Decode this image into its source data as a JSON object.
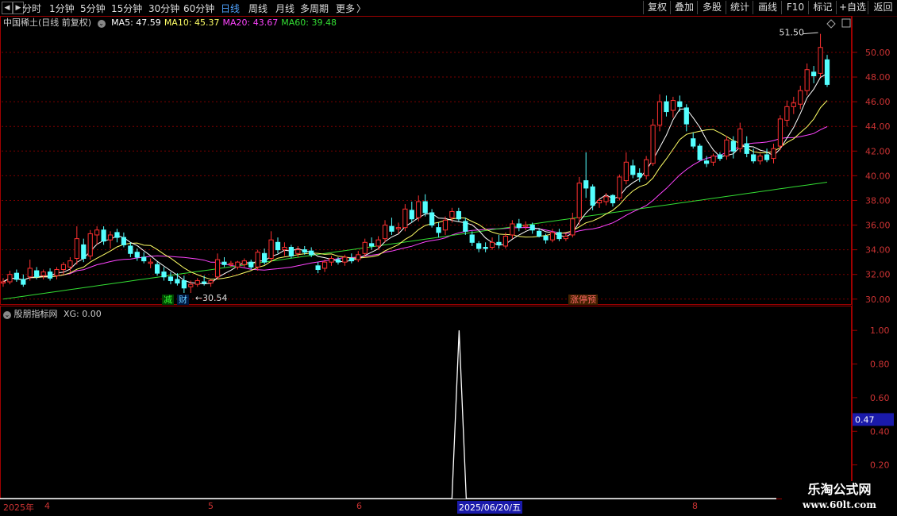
{
  "toolbar": {
    "nav_prev": "◀",
    "nav_next": "▶",
    "periods": [
      "分时",
      "1分钟",
      "5分钟",
      "15分钟",
      "30分钟",
      "60分钟",
      "日线",
      "周线",
      "月线",
      "多周期",
      "更多"
    ],
    "active_period": "日线",
    "more_arrow": "〉",
    "right_buttons": [
      "复权",
      "叠加",
      "多股",
      "统计",
      "画线",
      "F10",
      "标记",
      "+自选",
      "返回"
    ]
  },
  "stock": {
    "name": "中国稀土(日线 前复权)",
    "ma": [
      {
        "label": "MA5: 47.59",
        "color": "#ffffff"
      },
      {
        "label": "MA10: 45.37",
        "color": "#ffff66"
      },
      {
        "label": "MA20: 43.67",
        "color": "#ff44ff"
      },
      {
        "label": "MA60: 39.48",
        "color": "#33dd33"
      }
    ]
  },
  "price_axis": {
    "ticks": [
      "50.00",
      "48.00",
      "46.00",
      "44.00",
      "42.00",
      "40.00",
      "38.00",
      "36.00",
      "34.00",
      "32.00",
      "30.00"
    ]
  },
  "annotations": {
    "high": "51.50",
    "low": "30.54"
  },
  "markers": [
    {
      "text": "减",
      "color": "#33ff33",
      "bg": "#004400"
    },
    {
      "text": "财",
      "color": "#66ccff",
      "bg": "#001a44"
    },
    {
      "text": "涨停预",
      "color": "#ff6666",
      "bg": "#442200"
    }
  ],
  "indicator": {
    "title": "股朋指标网",
    "value": "XG: 0.00",
    "ticks": [
      "1.00",
      "0.80",
      "0.60",
      "0.40",
      "0.20"
    ],
    "cursor_value": "0.47"
  },
  "xaxis": {
    "year": "2025年",
    "months": [
      "4",
      "5",
      "6",
      "8"
    ],
    "cursor_date": "2025/06/20/五"
  },
  "watermark": {
    "line1": "乐淘公式网",
    "line2": "www.60lt.com"
  },
  "colors": {
    "up": "#ff3030",
    "down": "#54ffff",
    "grid": "#7a0000",
    "axis": "#a00000"
  },
  "chart_data": {
    "type": "candlestick",
    "title": "中国稀土(日线 前复权)",
    "ylim": [
      29.6,
      51.8
    ],
    "candles": [
      [
        31.3,
        31.7,
        31.0,
        31.4
      ],
      [
        31.4,
        32.3,
        31.2,
        32.0
      ],
      [
        32.1,
        32.4,
        31.4,
        31.6
      ],
      [
        31.6,
        32.0,
        31.0,
        31.2
      ],
      [
        31.8,
        33.2,
        31.5,
        32.5
      ],
      [
        32.3,
        32.6,
        31.6,
        31.8
      ],
      [
        31.9,
        32.4,
        31.6,
        32.2
      ],
      [
        32.2,
        32.5,
        31.5,
        31.7
      ],
      [
        31.9,
        32.6,
        31.6,
        32.4
      ],
      [
        32.4,
        33.0,
        32.0,
        32.8
      ],
      [
        32.6,
        33.4,
        32.2,
        33.1
      ],
      [
        33.3,
        35.9,
        32.8,
        34.9
      ],
      [
        34.4,
        34.9,
        33.0,
        33.3
      ],
      [
        33.5,
        35.6,
        33.2,
        35.3
      ],
      [
        35.2,
        35.9,
        34.4,
        35.6
      ],
      [
        35.6,
        35.9,
        34.4,
        34.7
      ],
      [
        34.8,
        35.5,
        34.1,
        35.2
      ],
      [
        35.4,
        35.7,
        34.6,
        35.0
      ],
      [
        35.0,
        35.4,
        34.2,
        34.4
      ],
      [
        34.3,
        34.6,
        33.4,
        33.7
      ],
      [
        33.8,
        34.1,
        33.1,
        33.4
      ],
      [
        33.4,
        33.8,
        32.9,
        33.1
      ],
      [
        32.9,
        33.3,
        32.5,
        33.0
      ],
      [
        32.8,
        33.0,
        31.9,
        32.1
      ],
      [
        32.2,
        32.6,
        31.5,
        31.8
      ],
      [
        31.8,
        32.2,
        31.2,
        31.5
      ],
      [
        31.6,
        32.1,
        31.1,
        31.3
      ],
      [
        31.5,
        31.9,
        30.5,
        30.9
      ],
      [
        31.0,
        31.5,
        30.5,
        31.2
      ],
      [
        31.2,
        31.7,
        31.0,
        31.5
      ],
      [
        31.4,
        31.9,
        31.1,
        31.3
      ],
      [
        31.3,
        31.6,
        31.0,
        31.5
      ],
      [
        31.8,
        33.7,
        31.6,
        33.2
      ],
      [
        33.0,
        33.4,
        32.6,
        32.8
      ],
      [
        32.8,
        33.1,
        32.6,
        32.9
      ],
      [
        32.6,
        33.1,
        32.4,
        33.0
      ],
      [
        32.8,
        33.3,
        32.6,
        33.1
      ],
      [
        33.0,
        33.2,
        32.4,
        32.6
      ],
      [
        32.6,
        34.0,
        32.3,
        33.8
      ],
      [
        33.7,
        34.1,
        32.8,
        33.0
      ],
      [
        33.3,
        35.5,
        33.0,
        34.8
      ],
      [
        34.6,
        35.0,
        33.7,
        34.0
      ],
      [
        34.0,
        34.6,
        33.5,
        34.2
      ],
      [
        34.2,
        34.4,
        33.3,
        33.5
      ],
      [
        33.7,
        34.3,
        33.4,
        34.0
      ],
      [
        34.0,
        34.3,
        33.6,
        33.8
      ],
      [
        33.9,
        34.2,
        33.4,
        33.6
      ],
      [
        32.7,
        33.0,
        32.1,
        32.4
      ],
      [
        32.5,
        33.2,
        32.2,
        33.0
      ],
      [
        33.0,
        33.5,
        32.7,
        33.3
      ],
      [
        33.2,
        33.4,
        32.8,
        33.0
      ],
      [
        33.0,
        33.6,
        32.7,
        33.4
      ],
      [
        33.3,
        33.7,
        32.9,
        33.1
      ],
      [
        33.2,
        33.9,
        33.0,
        33.6
      ],
      [
        33.7,
        34.9,
        33.4,
        34.6
      ],
      [
        34.5,
        35.0,
        34.0,
        34.3
      ],
      [
        34.3,
        35.1,
        34.0,
        34.8
      ],
      [
        34.9,
        36.4,
        34.6,
        36.0
      ],
      [
        35.9,
        36.6,
        35.2,
        35.5
      ],
      [
        35.7,
        36.2,
        35.3,
        35.8
      ],
      [
        35.8,
        37.7,
        35.5,
        37.3
      ],
      [
        37.2,
        37.9,
        36.2,
        36.5
      ],
      [
        36.6,
        38.4,
        36.3,
        37.9
      ],
      [
        37.9,
        38.5,
        36.7,
        37.0
      ],
      [
        37.0,
        37.3,
        35.8,
        36.0
      ],
      [
        35.8,
        36.2,
        35.0,
        35.4
      ],
      [
        35.6,
        36.7,
        35.2,
        36.4
      ],
      [
        36.6,
        37.4,
        36.2,
        37.1
      ],
      [
        37.1,
        37.4,
        36.3,
        36.5
      ],
      [
        36.3,
        36.6,
        35.2,
        35.5
      ],
      [
        35.2,
        35.5,
        34.3,
        34.6
      ],
      [
        34.5,
        34.7,
        33.8,
        34.1
      ],
      [
        34.2,
        34.6,
        33.8,
        34.1
      ],
      [
        34.2,
        35.0,
        34.0,
        34.6
      ],
      [
        34.6,
        35.2,
        34.1,
        34.4
      ],
      [
        34.3,
        35.4,
        34.1,
        35.1
      ],
      [
        35.2,
        36.4,
        34.9,
        36.1
      ],
      [
        36.1,
        36.5,
        35.5,
        35.8
      ],
      [
        35.9,
        36.3,
        35.6,
        36.0
      ],
      [
        36.0,
        36.2,
        35.3,
        35.6
      ],
      [
        35.5,
        35.7,
        35.0,
        35.1
      ],
      [
        35.1,
        35.3,
        34.5,
        34.8
      ],
      [
        34.8,
        35.7,
        34.6,
        35.4
      ],
      [
        35.4,
        35.7,
        34.7,
        34.9
      ],
      [
        34.9,
        35.3,
        34.7,
        35.1
      ],
      [
        35.2,
        37.0,
        35.0,
        36.5
      ],
      [
        36.6,
        39.9,
        36.0,
        39.4
      ],
      [
        39.6,
        41.9,
        38.2,
        39.0
      ],
      [
        39.1,
        39.3,
        37.2,
        37.6
      ],
      [
        37.8,
        38.2,
        37.4,
        38.0
      ],
      [
        37.9,
        38.6,
        37.6,
        38.3
      ],
      [
        38.4,
        38.5,
        37.5,
        37.8
      ],
      [
        38.2,
        40.1,
        38.0,
        39.9
      ],
      [
        39.6,
        41.9,
        39.3,
        41.1
      ],
      [
        40.8,
        41.3,
        39.8,
        40.1
      ],
      [
        40.2,
        40.6,
        39.5,
        39.9
      ],
      [
        40.0,
        41.6,
        39.7,
        41.3
      ],
      [
        41.0,
        44.6,
        40.8,
        44.1
      ],
      [
        44.1,
        46.6,
        43.6,
        46.0
      ],
      [
        46.0,
        46.5,
        44.8,
        45.2
      ],
      [
        45.3,
        46.4,
        44.7,
        46.1
      ],
      [
        46.0,
        46.5,
        45.2,
        45.6
      ],
      [
        45.5,
        45.8,
        43.6,
        44.2
      ],
      [
        43.0,
        43.5,
        42.2,
        42.4
      ],
      [
        42.4,
        42.6,
        41.2,
        41.3
      ],
      [
        41.2,
        41.6,
        40.7,
        41.0
      ],
      [
        41.1,
        41.8,
        40.8,
        41.6
      ],
      [
        41.7,
        41.9,
        41.2,
        41.4
      ],
      [
        41.6,
        43.2,
        41.3,
        42.9
      ],
      [
        42.8,
        43.2,
        41.4,
        42.0
      ],
      [
        42.2,
        44.3,
        41.9,
        43.8
      ],
      [
        42.6,
        43.2,
        41.5,
        41.8
      ],
      [
        41.7,
        42.2,
        41.0,
        41.2
      ],
      [
        41.2,
        41.8,
        40.9,
        41.6
      ],
      [
        41.7,
        42.2,
        41.1,
        41.3
      ],
      [
        41.4,
        42.6,
        41.0,
        42.2
      ],
      [
        42.4,
        44.9,
        42.1,
        44.6
      ],
      [
        44.5,
        46.1,
        44.0,
        45.6
      ],
      [
        45.6,
        46.4,
        45.0,
        45.9
      ],
      [
        45.8,
        47.3,
        45.4,
        46.9
      ],
      [
        46.9,
        49.1,
        46.5,
        48.6
      ],
      [
        48.4,
        48.9,
        47.5,
        48.1
      ],
      [
        48.3,
        51.5,
        48.0,
        50.4
      ],
      [
        49.4,
        49.8,
        47.2,
        47.4
      ]
    ],
    "indicator_xg_peak_index": 68,
    "indicator_ylim": [
      0,
      1.1
    ]
  }
}
